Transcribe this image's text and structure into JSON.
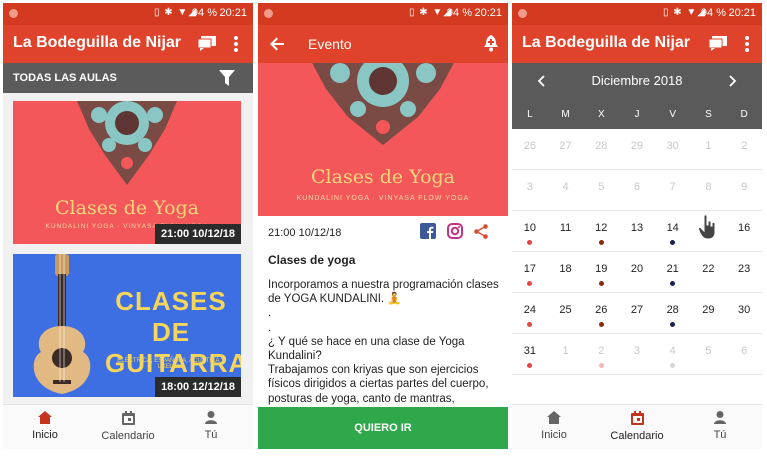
{
  "status": {
    "signal_icons": "▯ ✱ ▼◢",
    "battery": "94 %",
    "time": "20:21"
  },
  "screen_inicio": {
    "app_title": "La Bodeguilla de Nijar",
    "filter_label": "TODAS LAS AULAS",
    "cards": [
      {
        "title": "Clases de Yoga",
        "subtitle": "KUNDALINI YOGA · VINYASA FLOW YOGA",
        "datetime": "21:00 10/12/18"
      },
      {
        "title_line1": "CLASES DE",
        "title_line2": "GUITARRA",
        "subtitle": "ELECTRICA, ESPAÑOLA, ACUSTICA Y UKELELE",
        "datetime": "18:00 12/12/18"
      }
    ]
  },
  "nav": {
    "inicio": "Inicio",
    "calendario": "Calendario",
    "tu": "Tú"
  },
  "screen_evento": {
    "title": "Evento",
    "banner_title": "Clases de Yoga",
    "banner_subtitle": "KUNDALINI YOGA · VINYASA FLOW YOGA",
    "datetime": "21:00 10/12/18",
    "event_title": "Clases de yoga",
    "body": [
      "Incorporamos a nuestra programación clases de YOGA KUNDALINI. 🧘",
      ".",
      ".",
      "¿ Y qué se hace en una clase de Yoga Kundalini?",
      "Trabajamos con kriyas que son ejercicios físicos dirigidos a ciertas partes del cuerpo, posturas de yoga, canto de mantras, respiraciones, meditaciones dinámicas y una"
    ],
    "cta": "QUIERO IR"
  },
  "screen_calendario": {
    "app_title": "La Bodeguilla de Nijar",
    "month": "Diciembre  2018",
    "weekdays": [
      "L",
      "M",
      "X",
      "J",
      "V",
      "S",
      "D"
    ],
    "weeks": [
      [
        [
          "26",
          1,
          ""
        ],
        [
          "27",
          1,
          ""
        ],
        [
          "28",
          1,
          ""
        ],
        [
          "29",
          1,
          ""
        ],
        [
          "30",
          1,
          ""
        ],
        [
          "1",
          1,
          ""
        ],
        [
          "2",
          1,
          ""
        ]
      ],
      [
        [
          "3",
          1,
          ""
        ],
        [
          "4",
          1,
          ""
        ],
        [
          "5",
          1,
          ""
        ],
        [
          "6",
          1,
          ""
        ],
        [
          "7",
          1,
          ""
        ],
        [
          "8",
          1,
          ""
        ],
        [
          "9",
          1,
          ""
        ]
      ],
      [
        [
          "10",
          0,
          "#e64545"
        ],
        [
          "11",
          0,
          ""
        ],
        [
          "12",
          0,
          "#8c2a0e"
        ],
        [
          "13",
          0,
          ""
        ],
        [
          "14",
          0,
          "#1c2245"
        ],
        [
          "15",
          0,
          ""
        ],
        [
          "16",
          0,
          ""
        ]
      ],
      [
        [
          "17",
          0,
          "#e64545"
        ],
        [
          "18",
          0,
          ""
        ],
        [
          "19",
          0,
          "#8c2a0e"
        ],
        [
          "20",
          0,
          ""
        ],
        [
          "21",
          0,
          "#1c2245"
        ],
        [
          "22",
          0,
          ""
        ],
        [
          "23",
          0,
          ""
        ]
      ],
      [
        [
          "24",
          0,
          "#e64545"
        ],
        [
          "25",
          0,
          ""
        ],
        [
          "26",
          0,
          "#8c2a0e"
        ],
        [
          "27",
          0,
          ""
        ],
        [
          "28",
          0,
          "#1c2245"
        ],
        [
          "29",
          0,
          ""
        ],
        [
          "30",
          0,
          ""
        ]
      ],
      [
        [
          "31",
          0,
          "#e64545"
        ],
        [
          "1",
          1,
          ""
        ],
        [
          "2",
          1,
          "#f3b9b9"
        ],
        [
          "3",
          1,
          ""
        ],
        [
          "4",
          1,
          "#d6d6d6"
        ],
        [
          "5",
          1,
          ""
        ],
        [
          "6",
          1,
          ""
        ]
      ]
    ]
  },
  "colors": {
    "appbar": "#e0432b",
    "statusbar": "#d43a1f",
    "cta": "#2ea84a",
    "accent": "#c5341c"
  }
}
